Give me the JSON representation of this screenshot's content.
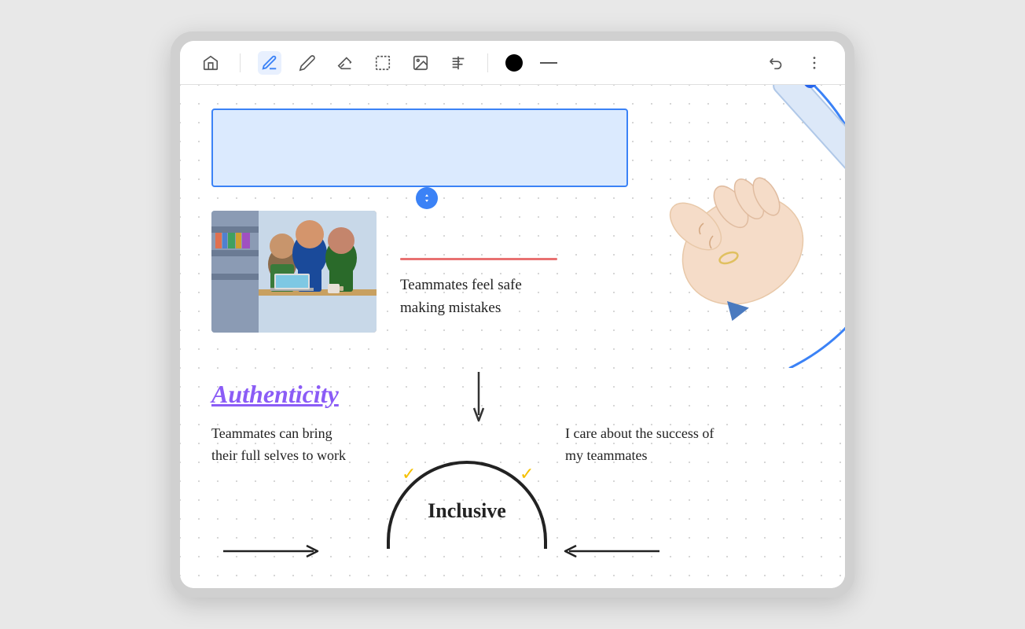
{
  "toolbar": {
    "home_icon": "⌂",
    "pen_icon": "✏",
    "pencil_icon": "✎",
    "eraser_icon": "⌫",
    "select_icon": "⬚",
    "image_icon": "▣",
    "text_icon": "T",
    "color_black": "#000000",
    "stroke_icon": "—",
    "undo_icon": "↩",
    "more_icon": "⋮",
    "active_tool": "pen"
  },
  "canvas": {
    "blue_box_visible": true,
    "authenticity_label": "Authenticity",
    "teammates_can_text": "Teammates can bring their full selves to work",
    "teammates_feel_text": "Teammates feel safe making mistakes",
    "inclusive_label": "Inclusive",
    "i_care_text": "I care about the success of my teammates"
  }
}
